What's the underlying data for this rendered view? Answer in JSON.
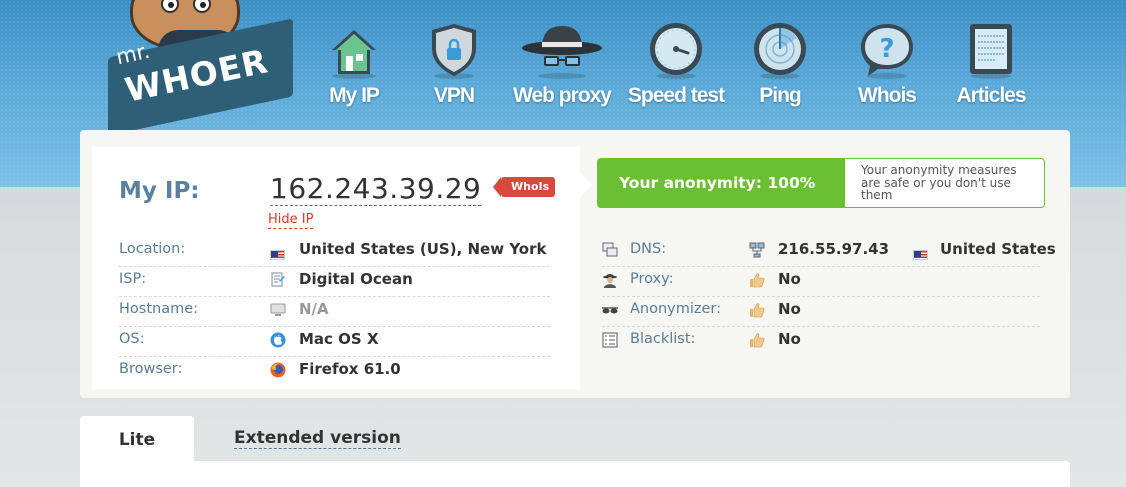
{
  "logo": {
    "mr": "mr.",
    "brand": "WHOER"
  },
  "nav": [
    {
      "label": "My IP",
      "icon": "house-icon"
    },
    {
      "label": "VPN",
      "icon": "shield-lock-icon"
    },
    {
      "label": "Web proxy",
      "icon": "spy-hat-icon"
    },
    {
      "label": "Speed test",
      "icon": "speedometer-icon"
    },
    {
      "label": "Ping",
      "icon": "radar-icon"
    },
    {
      "label": "Whois",
      "icon": "question-bubble-icon"
    },
    {
      "label": "Articles",
      "icon": "document-icon"
    }
  ],
  "ip": {
    "label": "My IP:",
    "value": "162.243.39.29",
    "hide_link": "Hide IP",
    "whois_badge": "WhoIs"
  },
  "left_rows": [
    {
      "label": "Location:",
      "icon": "us-flag-icon",
      "value": "United States (US), New York",
      "muted": false
    },
    {
      "label": "ISP:",
      "icon": "isp-icon",
      "value": "Digital Ocean",
      "muted": false
    },
    {
      "label": "Hostname:",
      "icon": "computer-icon",
      "value": "N/A",
      "muted": true
    },
    {
      "label": "OS:",
      "icon": "apple-icon",
      "value": "Mac OS X",
      "muted": false
    },
    {
      "label": "Browser:",
      "icon": "firefox-icon",
      "value": "Firefox 61.0",
      "muted": false
    }
  ],
  "anonymity": {
    "score_text": "Your anonymity: 100%",
    "note": "Your anonymity measures are safe or you don't use them",
    "color": "#6bbf32"
  },
  "right_rows": [
    {
      "label": "DNS:",
      "icon": "dns-icon",
      "value_icon": "network-icon",
      "value": "216.55.97.43",
      "country": "United States"
    },
    {
      "label": "Proxy:",
      "icon": "spy-icon",
      "value_icon": "thumbs-up-icon",
      "value": "No"
    },
    {
      "label": "Anonymizer:",
      "icon": "glasses-icon",
      "value_icon": "thumbs-up-icon",
      "value": "No"
    },
    {
      "label": "Blacklist:",
      "icon": "list-icon",
      "value_icon": "thumbs-up-icon",
      "value": "No"
    }
  ],
  "tabs": {
    "lite": "Lite",
    "extended": "Extended version"
  },
  "colors": {
    "header": "#4a9ccf",
    "label": "#5a7c96",
    "accent_red": "#d6493c",
    "green": "#6bbf32"
  }
}
